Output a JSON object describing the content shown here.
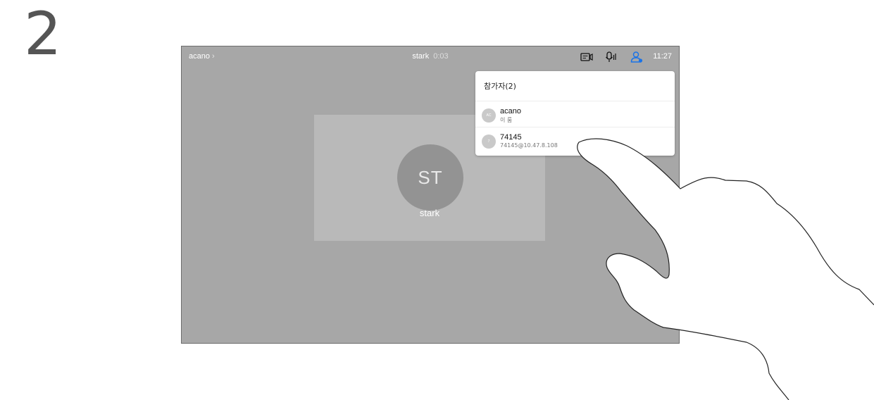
{
  "step": {
    "number": "2"
  },
  "topbar": {
    "breadcrumb": "acano",
    "breadcrumb_chevron": "›",
    "call_name": "stark",
    "call_timer": "0:03",
    "clock": "11:27",
    "icons": [
      "video-layout-icon",
      "microphone-icon",
      "participants-icon"
    ],
    "accent_color": "#1a73e8"
  },
  "main": {
    "participant_tile": {
      "initials": "ST",
      "name": "stark"
    }
  },
  "participants_panel": {
    "title": "참가자(2)",
    "items": [
      {
        "initials": "AC",
        "name": "acano",
        "detail": "이 룸"
      },
      {
        "initials": "7",
        "name": "74145",
        "detail": "74145@10.47.8.108"
      }
    ]
  }
}
